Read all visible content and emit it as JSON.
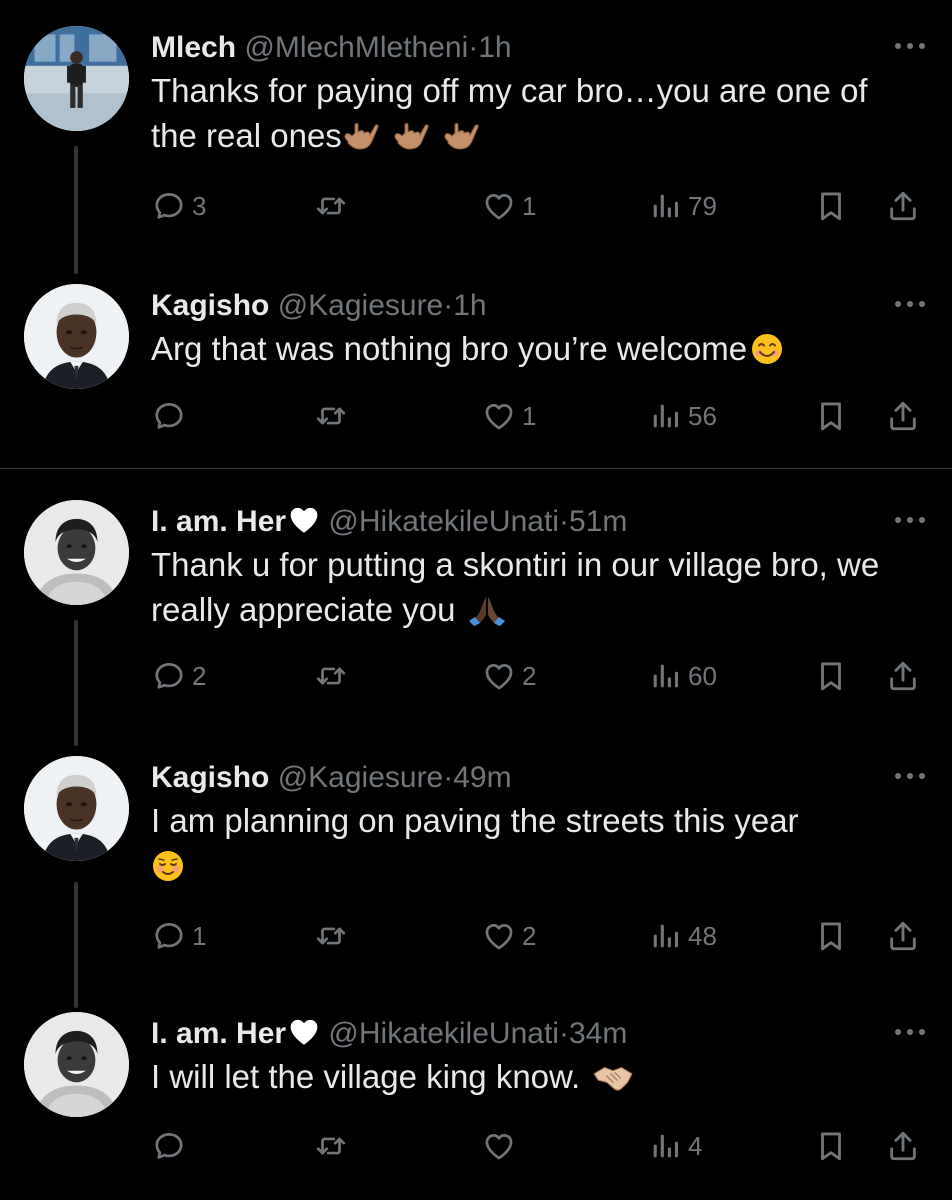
{
  "tweets": [
    {
      "name": "Mlech",
      "handle": "@MlechMletheni",
      "dot": "·",
      "time": "1h",
      "text": "Thanks for paying off my car bro…you are one of the real ones",
      "emojis": [
        "call-me-hand-icon",
        "call-me-hand-icon",
        "call-me-hand-icon"
      ],
      "replies": "3",
      "retweets": "",
      "likes": "1",
      "views": "79"
    },
    {
      "name": "Kagisho",
      "handle": "@Kagiesure",
      "dot": "·",
      "time": "1h",
      "text": "Arg that was nothing bro you’re welcome",
      "emojis": [
        "smiling-face-icon"
      ],
      "replies": "",
      "retweets": "",
      "likes": "1",
      "views": "56"
    },
    {
      "name": "I. am. Her",
      "handle": "@HikatekileUnati",
      "dot": "·",
      "time": "51m",
      "text": "Thank u for putting a skontiri in our village bro, we really appreciate you",
      "emojis": [
        "folded-hands-icon"
      ],
      "replies": "2",
      "retweets": "",
      "likes": "2",
      "views": "60"
    },
    {
      "name": "Kagisho",
      "handle": "@Kagiesure",
      "dot": "·",
      "time": "49m",
      "text": "I am planning on paving the streets this year",
      "emojis": [
        "blushing-face-icon"
      ],
      "replies": "1",
      "retweets": "",
      "likes": "2",
      "views": "48"
    },
    {
      "name": "I. am. Her",
      "handle": "@HikatekileUnati",
      "dot": "·",
      "time": "34m",
      "text": "I will let the village king know.",
      "emojis": [
        "handshake-icon"
      ],
      "replies": "",
      "retweets": "",
      "likes": "",
      "views": "4"
    }
  ],
  "colors": {
    "background": "#000000",
    "text_primary": "#e7e9ea",
    "text_secondary": "#71767b",
    "divider": "#2f3336",
    "thread_line": "#333639"
  }
}
